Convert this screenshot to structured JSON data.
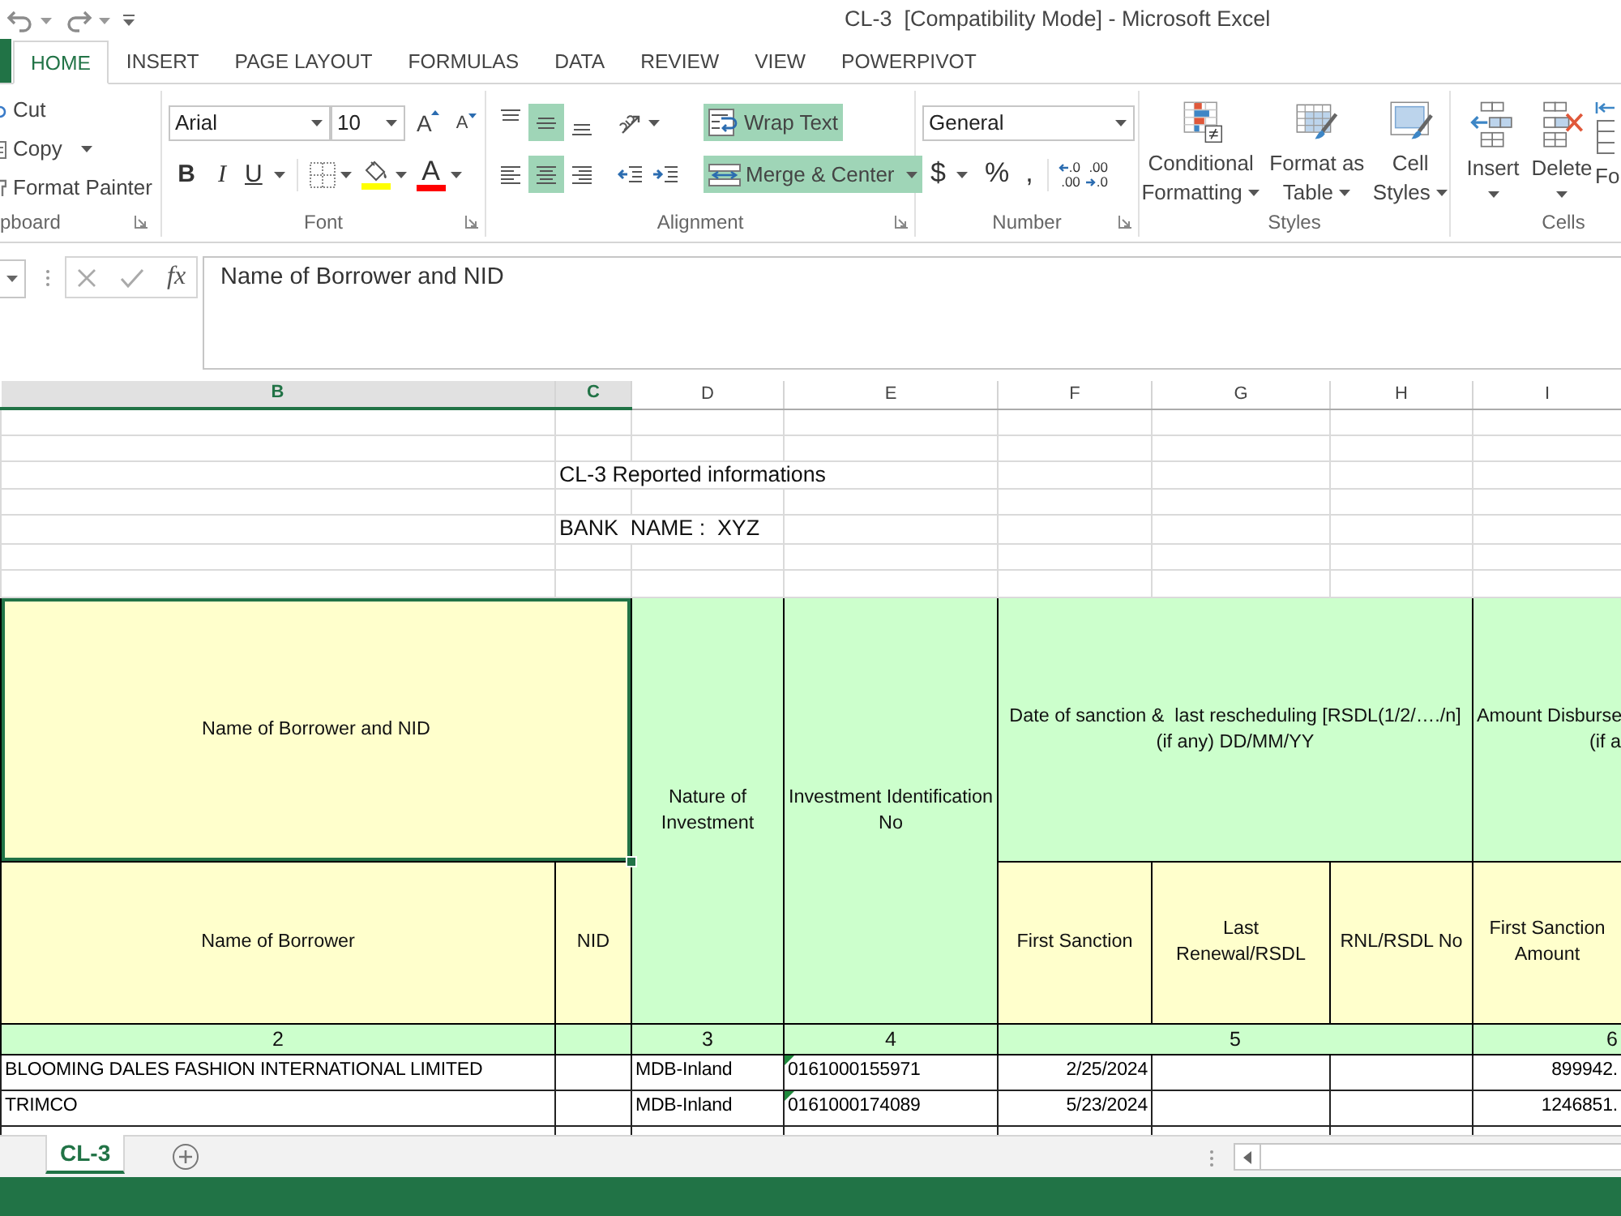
{
  "window": {
    "title": "CL-3  [Compatibility Mode] - Microsoft Excel"
  },
  "ribbon_tabs": [
    {
      "label": "HOME",
      "selected": true
    },
    {
      "label": "INSERT",
      "selected": false
    },
    {
      "label": "PAGE LAYOUT",
      "selected": false
    },
    {
      "label": "FORMULAS",
      "selected": false
    },
    {
      "label": "DATA",
      "selected": false
    },
    {
      "label": "REVIEW",
      "selected": false
    },
    {
      "label": "VIEW",
      "selected": false
    },
    {
      "label": "POWERPIVOT",
      "selected": false
    }
  ],
  "ribbon": {
    "clipboard": {
      "items": [
        "Cut",
        "Copy",
        "Format Painter"
      ],
      "label": "pboard"
    },
    "font": {
      "font_name": "Arial",
      "font_size": "10",
      "grow": "A",
      "shrink": "A",
      "styles": [
        "B",
        "I",
        "U"
      ],
      "font_color_letter": "A",
      "label": "Font"
    },
    "alignment": {
      "vertical": [
        {
          "kind": "top",
          "on": false
        },
        {
          "kind": "middle",
          "on": true
        },
        {
          "kind": "bottom",
          "on": false
        }
      ],
      "horizontal": [
        {
          "kind": "left",
          "on": false
        },
        {
          "kind": "center",
          "on": true
        },
        {
          "kind": "right",
          "on": false
        }
      ],
      "wrap_text": {
        "label": "Wrap Text",
        "on": true
      },
      "merge": {
        "label": "Merge & Center",
        "on": true
      },
      "label": "Alignment"
    },
    "number": {
      "format": "General",
      "symbols": [
        "$",
        "%",
        ","
      ],
      "increase_decimal": [
        ".0",
        ".00"
      ],
      "decrease_decimal": [
        ".00",
        ".0"
      ],
      "label": "Number"
    },
    "styles": {
      "buttons": [
        {
          "kind": "conditional",
          "lines": [
            "Conditional",
            "Formatting"
          ]
        },
        {
          "kind": "table",
          "lines": [
            "Format as",
            "Table"
          ]
        },
        {
          "kind": "cell_styles",
          "lines": [
            "Cell",
            "Styles"
          ]
        }
      ],
      "label": "Styles"
    },
    "cells": {
      "buttons": [
        {
          "kind": "insert",
          "label": "Insert"
        },
        {
          "kind": "delete",
          "label": "Delete"
        },
        {
          "kind": "format",
          "label": "Fo"
        }
      ],
      "label": "Cells"
    }
  },
  "formula_bar": {
    "function_label": "fx",
    "value": "Name of Borrower and NID"
  },
  "sheet": {
    "columns": [
      {
        "label": "B",
        "selected": true
      },
      {
        "label": "C",
        "selected": true
      },
      {
        "label": "D",
        "selected": false
      },
      {
        "label": "E",
        "selected": false
      },
      {
        "label": "F",
        "selected": false
      },
      {
        "label": "G",
        "selected": false
      },
      {
        "label": "H",
        "selected": false
      },
      {
        "label": "I",
        "selected": false
      }
    ],
    "report_title": "CL-3 Reported informations",
    "bank_name": "BANK  NAME :  XYZ",
    "header": {
      "borrower_group": {
        "label": "Name of Borrower and NID",
        "selected": true
      },
      "borrower_name": "Name of Borrower",
      "nid": "NID",
      "nature": "Nature of Investment",
      "investment_id": "Investment Identification No",
      "dates_group": "Date of sanction &  last rescheduling [RSDL(1/2/…./n] (if any) DD/MM/YY",
      "first_sanction": "First Sanction",
      "last_renewal": "Last Renewal/RSDL",
      "rnl_no": "RNL/RSDL No",
      "amount_group": [
        "Amount Disburse",
        "(if a"
      ],
      "first_sanction_amount": "First Sanction Amount"
    },
    "column_numbers": [
      "2",
      "3",
      "4",
      "5",
      "6"
    ],
    "rows": [
      {
        "borrower": "BLOOMING DALES FASHION INTERNATIONAL LIMITED",
        "nature": "MDB-Inland",
        "investment_id": "0161000155971",
        "id_flagged": true,
        "first_sanction": "2/25/2024",
        "amount": "899942."
      },
      {
        "borrower": "TRIMCO",
        "nature": "MDB-Inland",
        "investment_id": "0161000174089",
        "id_flagged": true,
        "first_sanction": "5/23/2024",
        "amount": "1246851."
      }
    ]
  },
  "sheet_tabs": [
    {
      "label": "CL-3",
      "selected": true
    }
  ]
}
